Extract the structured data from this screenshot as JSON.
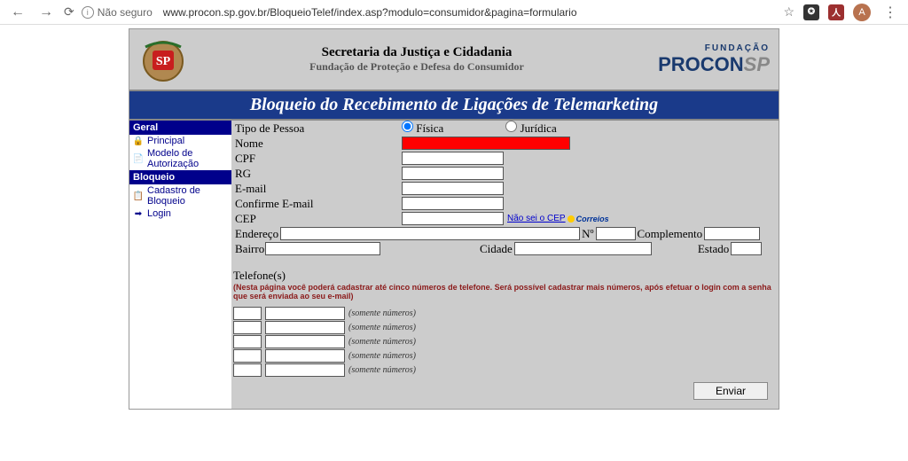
{
  "browser": {
    "insecure_label": "Não seguro",
    "url": "www.procon.sp.gov.br/BloqueioTelef/index.asp?modulo=consumidor&pagina=formulario",
    "avatar_letter": "A"
  },
  "header": {
    "line1": "Secretaria da Justiça e Cidadania",
    "line2": "Fundação de Proteção e Defesa do Consumidor",
    "logo_top": "FUNDAÇÃO",
    "logo_procon": "PROCON",
    "logo_sp": "SP"
  },
  "title_bar": "Bloqueio do Recebimento de Ligações de Telemarketing",
  "sidebar": {
    "section1": "Geral",
    "items1": [
      "Principal",
      "Modelo de Autorização"
    ],
    "section2": "Bloqueio",
    "items2": [
      "Cadastro de Bloqueio",
      "Login"
    ]
  },
  "form": {
    "tipo_pessoa_label": "Tipo de Pessoa",
    "tipo_fisica": "Física",
    "tipo_juridica": "Jurídica",
    "nome_label": "Nome",
    "cpf_label": "CPF",
    "rg_label": "RG",
    "email_label": "E-mail",
    "confirme_email_label": "Confirme E-mail",
    "cep_label": "CEP",
    "cep_link": "Não sei o CEP",
    "correios": "Correios",
    "endereco_label": "Endereço",
    "numero_label": "Nº",
    "complemento_label": "Complemento",
    "bairro_label": "Bairro",
    "cidade_label": "Cidade",
    "estado_label": "Estado",
    "telefones_label": "Telefone(s)",
    "telefones_note": "(Nesta página você poderá cadastrar até cinco números de telefone. Será possível cadastrar mais números, após efetuar o login com a senha que será enviada ao seu e-mail)",
    "tel_hint": "(somente números)",
    "submit": "Enviar"
  }
}
